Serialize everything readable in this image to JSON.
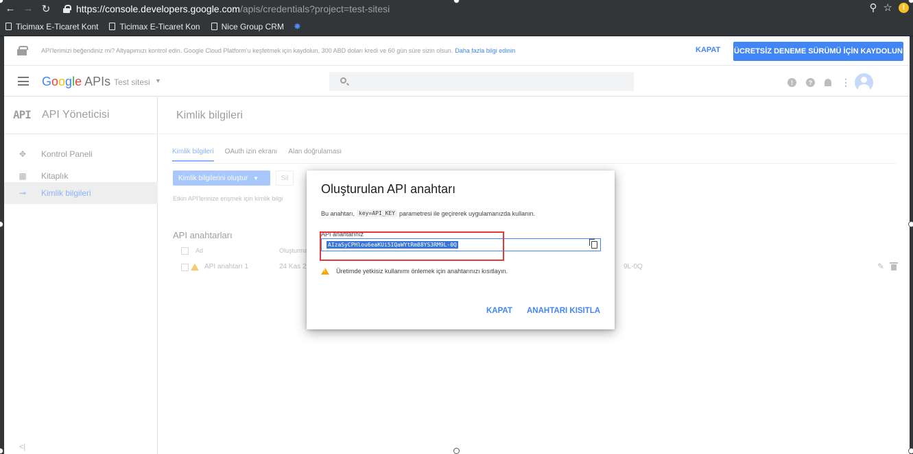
{
  "browser": {
    "url_host": "https://console.developers.google.com",
    "url_path": "/apis/credentials?project=test-sitesi",
    "bookmarks": [
      "Ticimax E-Ticaret Kont",
      "Ticimax E-Ticaret Kon",
      "Nice Group CRM"
    ]
  },
  "promo": {
    "text": "API'lerimizi beğendiniz mi? Altyapımızı kontrol edin. Google Cloud Platform'u keşfetmek için kaydolun, 300 ABD doları kredi ve 60 gün süre sizin olsun.",
    "link": "Daha fazla bilgi edinin",
    "close": "KAPAT",
    "cta": "ÜCRETSİZ DENEME SÜRÜMÜ İÇİN KAYDOLUN"
  },
  "appbar": {
    "brand_letters": [
      "G",
      "o",
      "o",
      "g",
      "l",
      "e"
    ],
    "brand_apis": " APIs",
    "project": "Test sitesi"
  },
  "sidebar": {
    "logo": "API",
    "title": "API Yöneticisi",
    "items": [
      {
        "label": "Kontrol Paneli",
        "icon": "dashboard-icon"
      },
      {
        "label": "Kitaplık",
        "icon": "library-icon"
      },
      {
        "label": "Kimlik bilgileri",
        "icon": "key-icon"
      }
    ]
  },
  "main": {
    "title": "Kimlik bilgileri",
    "tabs": [
      "Kimlik bilgileri",
      "OAuth izin ekranı",
      "Alan doğrulaması"
    ],
    "create_button": "Kimlik bilgilerini oluştur",
    "delete_button": "Sil",
    "hint": "Etkin API'lerinize erişmek için kimlik bilgi",
    "section_title": "API anahtarları",
    "columns": [
      "Ad",
      "Oluşturma"
    ],
    "row": {
      "name": "API anahtarı 1",
      "date": "24 Kas 20",
      "key_tail": "9L-0Q"
    }
  },
  "dialog": {
    "title": "Oluşturulan API anahtarı",
    "desc_before": "Bu anahtarı,",
    "desc_code": "key=API_KEY",
    "desc_after": "parametresi ile geçirerek uygulamanızda kullanın.",
    "key_label": "API anahtarınız",
    "key_value": "AIzaSyCPHlou6eaKUi5IQaWYtRm88YS3RM9L-0Q",
    "warning": "Üretimde yetkisiz kullanımı önlemek için anahtarınızı kısıtlayın.",
    "close_button": "KAPAT",
    "restrict_button": "ANAHTARI KISITLA"
  },
  "colors": {
    "accent": "#4285f4",
    "highlight": "#e53935",
    "warning": "#f6a800"
  }
}
